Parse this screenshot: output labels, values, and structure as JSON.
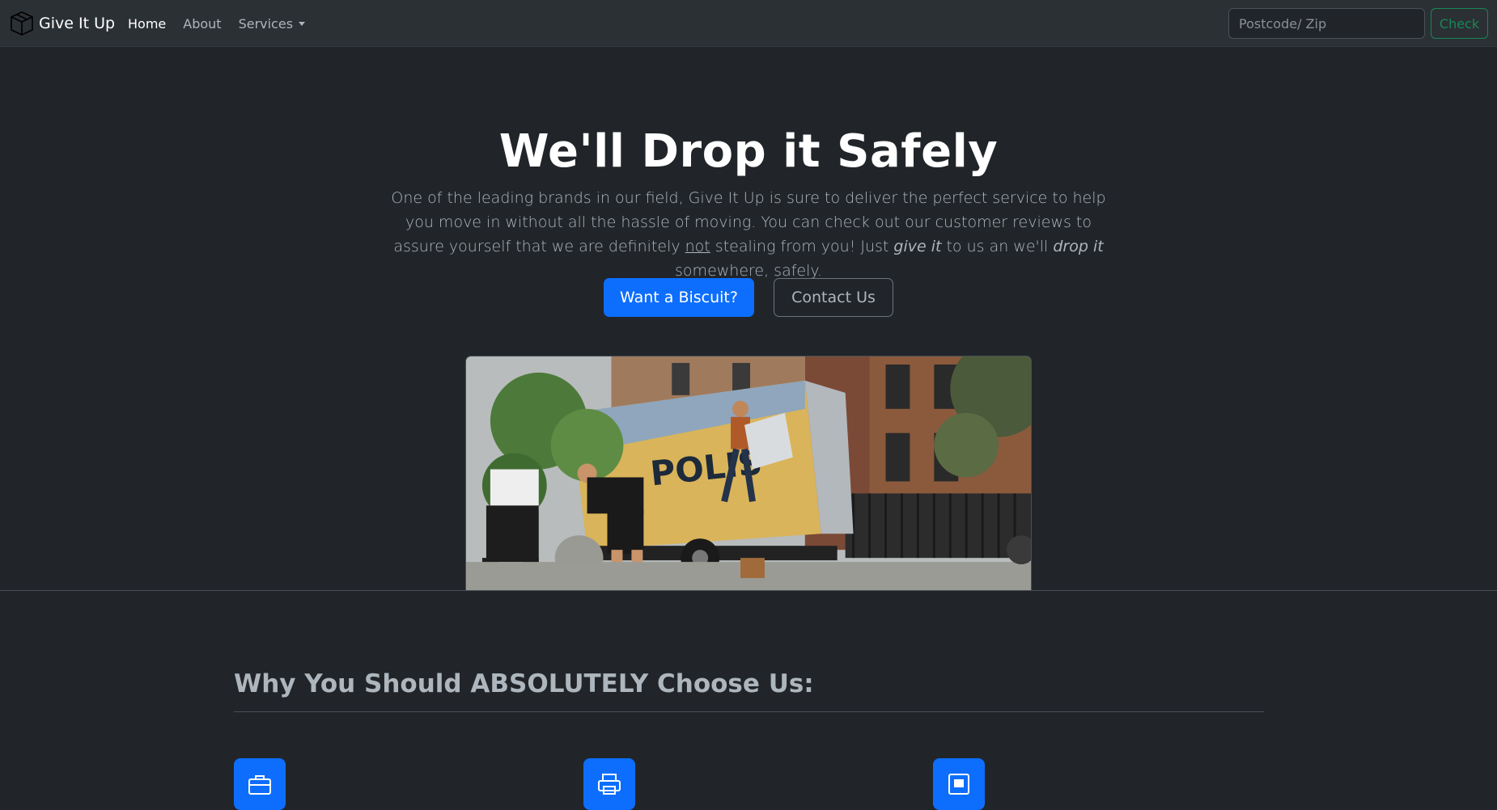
{
  "navbar": {
    "brand": "Give It Up",
    "brand_icon": "box-icon",
    "links": [
      {
        "label": "Home",
        "active": true
      },
      {
        "label": "About",
        "active": false
      },
      {
        "label": "Services",
        "active": false,
        "dropdown": true
      }
    ],
    "search": {
      "placeholder": "Postcode/ Zip",
      "value": ""
    },
    "check_label": "Check"
  },
  "hero": {
    "title": "We'll Drop it Safely",
    "lead": {
      "part1": "One of the leading brands in our field, Give It Up is sure to deliver the perfect service to help you move in without all the hassle of moving. You can check out our customer reviews to assure yourself that we are definitely ",
      "underline": "not",
      "part2": " stealing from you! Just ",
      "italic1": "give it",
      "part3": " to us an we'll ",
      "italic2": "drop it",
      "part4": " somewhere, safely."
    },
    "primary_button": "Want a Biscuit?",
    "secondary_button": "Contact Us",
    "image_label": "photo of movers loading a truck",
    "truck_text": "POLIS"
  },
  "features": {
    "title": "Why You Should ABSOLUTELY Choose Us:",
    "icons": [
      "briefcase-icon",
      "printer-icon",
      "window-icon"
    ]
  },
  "colors": {
    "background": "#212529",
    "navbar": "#2b3035",
    "primary": "#0d6efd",
    "success": "#198754",
    "muted": "#adb5bd"
  }
}
